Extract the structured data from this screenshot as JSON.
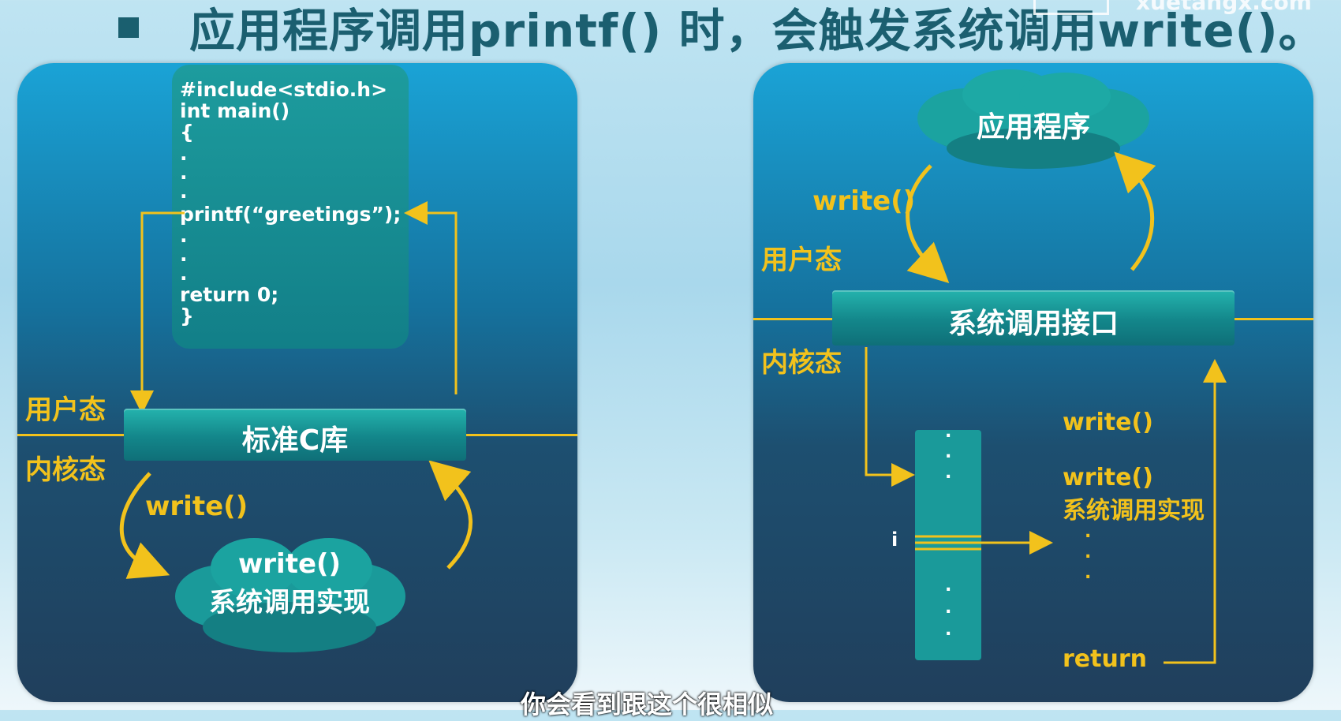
{
  "title": "应用程序调用printf() 时，会触发系统调用write()。",
  "watermark": "xuetangx.com",
  "left": {
    "code_lines": [
      "#include<stdio.h>",
      "int main()",
      "{",
      ".",
      ".",
      ".",
      "printf(“greetings”);",
      ".",
      ".",
      ".",
      "return 0;",
      "}"
    ],
    "user_mode": "用户态",
    "kernel_mode": "内核态",
    "bar_label": "标准C库",
    "write_label": "write()",
    "cloud_line1": "write()",
    "cloud_line2": "系统调用实现"
  },
  "right": {
    "cloud_label": "应用程序",
    "write_label": "write()",
    "user_mode": "用户态",
    "kernel_mode": "内核态",
    "bar_label": "系统调用接口",
    "table_dots_top": [
      ".",
      ".",
      "."
    ],
    "table_index": "i",
    "table_dots_bottom": [
      ".",
      ".",
      "."
    ],
    "impl_write1": "write()",
    "impl_write2": "write()",
    "impl_text": "系统调用实现",
    "impl_dots": [
      ".",
      ".",
      "."
    ],
    "impl_return": "return"
  },
  "subtitle": "你会看到跟这个很相似",
  "colors": {
    "accent": "#f2c21c",
    "teal": "#13868a",
    "title": "#1b5f70"
  }
}
